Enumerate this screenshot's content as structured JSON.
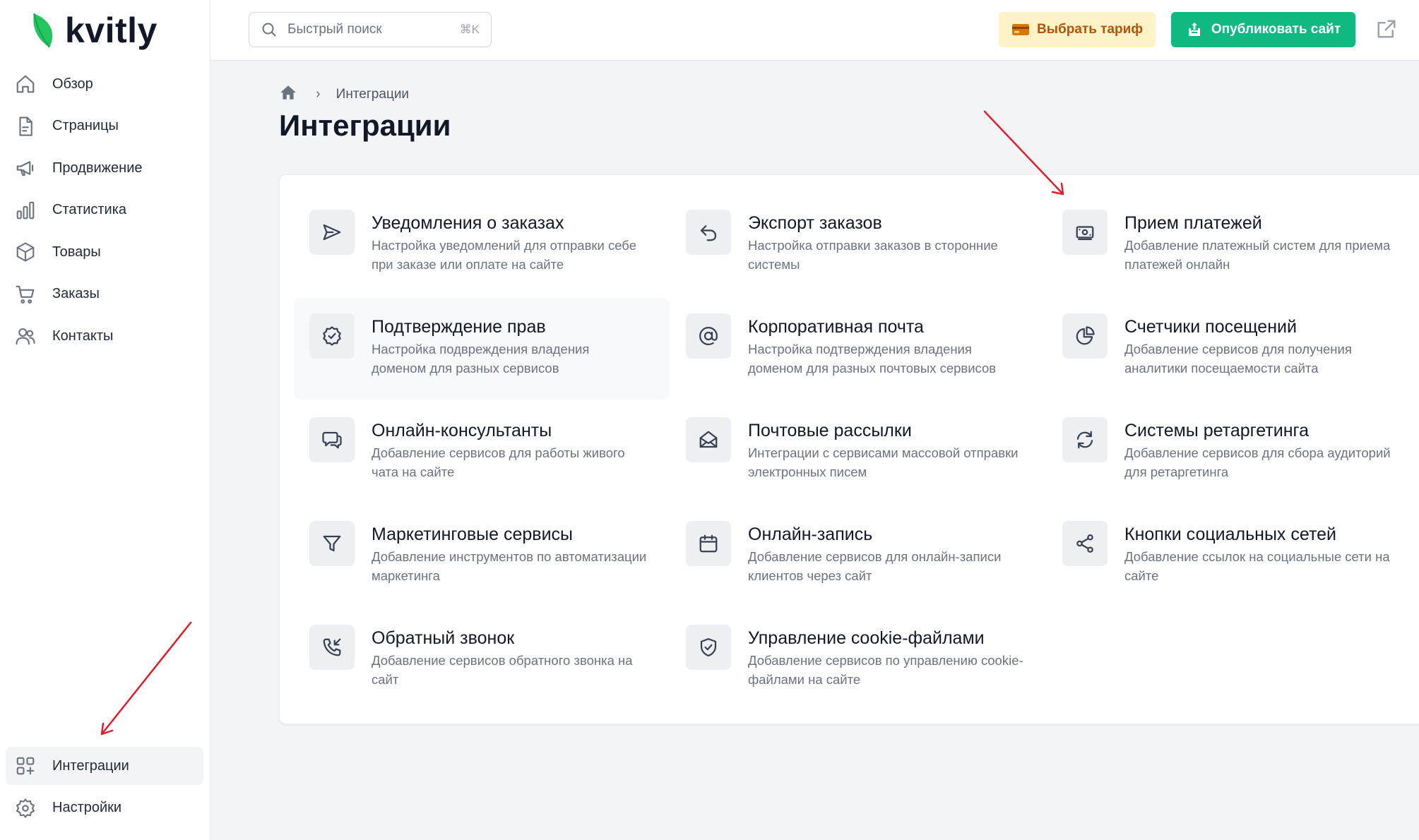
{
  "app": {
    "logo_text": "kvitly"
  },
  "sidebar": {
    "items": [
      {
        "label": "Обзор",
        "icon": "home-icon"
      },
      {
        "label": "Страницы",
        "icon": "document-icon"
      },
      {
        "label": "Продвижение",
        "icon": "megaphone-icon"
      },
      {
        "label": "Статистика",
        "icon": "bar-chart-icon"
      },
      {
        "label": "Товары",
        "icon": "box-icon"
      },
      {
        "label": "Заказы",
        "icon": "cart-icon"
      },
      {
        "label": "Контакты",
        "icon": "users-icon"
      }
    ],
    "bottom": [
      {
        "label": "Интеграции",
        "icon": "grid-plus-icon",
        "active": true
      },
      {
        "label": "Настройки",
        "icon": "gear-icon"
      }
    ]
  },
  "topbar": {
    "search_placeholder": "Быстрый поиск",
    "search_shortcut": "⌘K",
    "tariff_label": "Выбрать тариф",
    "publish_label": "Опубликовать сайт"
  },
  "breadcrumb": {
    "current": "Интеграции",
    "separator": "›"
  },
  "page": {
    "title": "Интеграции"
  },
  "integrations": [
    {
      "title": "Уведомления о заказах",
      "desc": "Настройка уведомлений для отправки себе при заказе или оплате на сайте",
      "icon": "send-icon"
    },
    {
      "title": "Экспорт заказов",
      "desc": "Настройка отправки заказов в сторонние системы",
      "icon": "undo-icon"
    },
    {
      "title": "Прием платежей",
      "desc": "Добавление платежный систем для приема платежей онлайн",
      "icon": "banknote-icon"
    },
    {
      "title": "Подтверждение прав",
      "desc": "Настройка подвреждения владения доменом для разных сервисов",
      "icon": "badge-check-icon"
    },
    {
      "title": "Корпоративная почта",
      "desc": "Настройка подтверждения владения доменом для разных почтовых сервисов",
      "icon": "at-sign-icon"
    },
    {
      "title": "Счетчики посещений",
      "desc": "Добавление сервисов для получения аналитики посещаемости сайта",
      "icon": "pie-chart-icon"
    },
    {
      "title": "Онлайн-консультанты",
      "desc": "Добавление сервисов для работы живого чата на сайте",
      "icon": "chat-icon"
    },
    {
      "title": "Почтовые рассылки",
      "desc": "Интеграции с сервисами массовой отправки электронных писем",
      "icon": "mail-open-icon"
    },
    {
      "title": "Системы ретаргетинга",
      "desc": "Добавление сервисов для сбора аудиторий для ретаргетинга",
      "icon": "refresh-icon"
    },
    {
      "title": "Маркетинговые сервисы",
      "desc": "Добавление инструментов по автоматизации маркетинга",
      "icon": "funnel-icon"
    },
    {
      "title": "Онлайн-запись",
      "desc": "Добавление сервисов для онлайн-записи клиентов через сайт",
      "icon": "calendar-icon"
    },
    {
      "title": "Кнопки социальных сетей",
      "desc": "Добавление ссылок на социальные сети на сайте",
      "icon": "share-icon"
    },
    {
      "title": "Обратный звонок",
      "desc": "Добавление сервисов обратного звонка на сайт",
      "icon": "phone-incoming-icon"
    },
    {
      "title": "Управление cookie-файлами",
      "desc": "Добавление сервисов по управлению cookie-файлами на сайте",
      "icon": "shield-check-icon"
    }
  ],
  "colors": {
    "accent_green": "#10b97f",
    "tariff_bg": "#fef3c7",
    "tariff_text": "#b45309",
    "annotation_red": "#e11d2e"
  }
}
